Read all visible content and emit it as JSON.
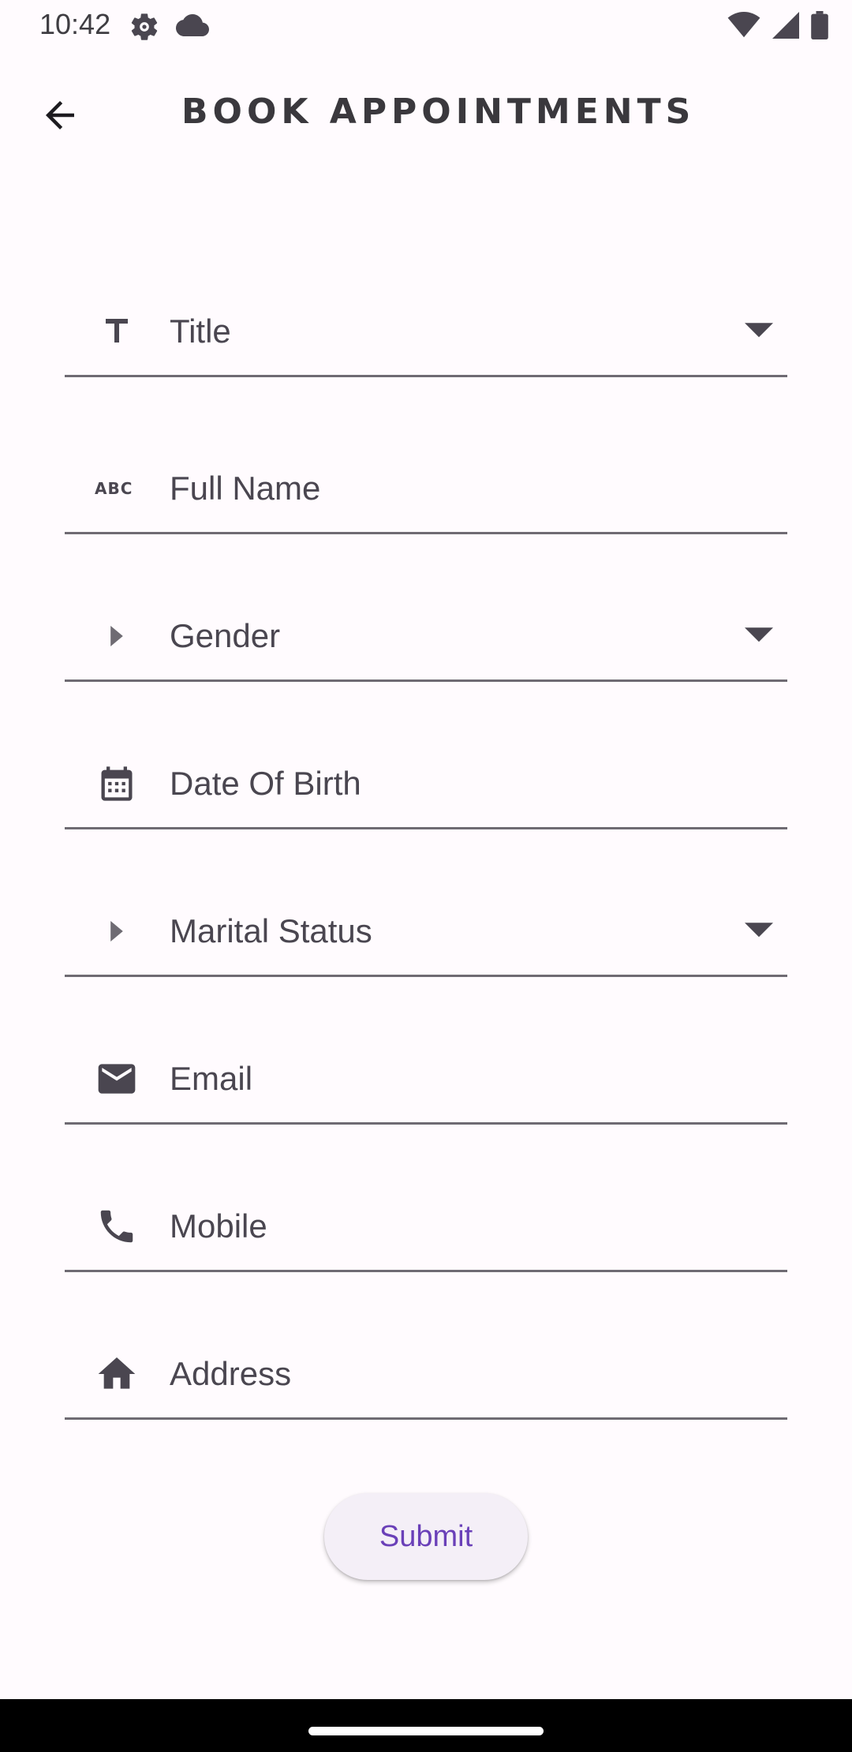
{
  "status_bar": {
    "time": "10:42",
    "icons": [
      "settings-gear-icon",
      "cloud-icon",
      "wifi-icon",
      "cell-signal-icon",
      "battery-icon"
    ]
  },
  "app_bar": {
    "title": "BOOK APPOINTMENTS",
    "back_icon": "arrow-back-icon"
  },
  "form": {
    "fields": [
      {
        "label": "Title",
        "icon": "title-text-icon",
        "type": "dropdown"
      },
      {
        "label": "Full Name",
        "icon": "abc-icon",
        "type": "text"
      },
      {
        "label": "Gender",
        "icon": "arrow-right-icon",
        "type": "dropdown"
      },
      {
        "label": "Date Of Birth",
        "icon": "calendar-icon",
        "type": "text"
      },
      {
        "label": "Marital Status",
        "icon": "arrow-right-icon",
        "type": "dropdown"
      },
      {
        "label": "Email",
        "icon": "email-icon",
        "type": "text"
      },
      {
        "label": "Mobile",
        "icon": "phone-icon",
        "type": "text"
      },
      {
        "label": "Address",
        "icon": "home-icon",
        "type": "text"
      }
    ],
    "submit_label": "Submit"
  },
  "colors": {
    "background": "#fffbfe",
    "accent": "#6a40b8",
    "icon": "#4a4650",
    "underline": "#6f6b73"
  }
}
